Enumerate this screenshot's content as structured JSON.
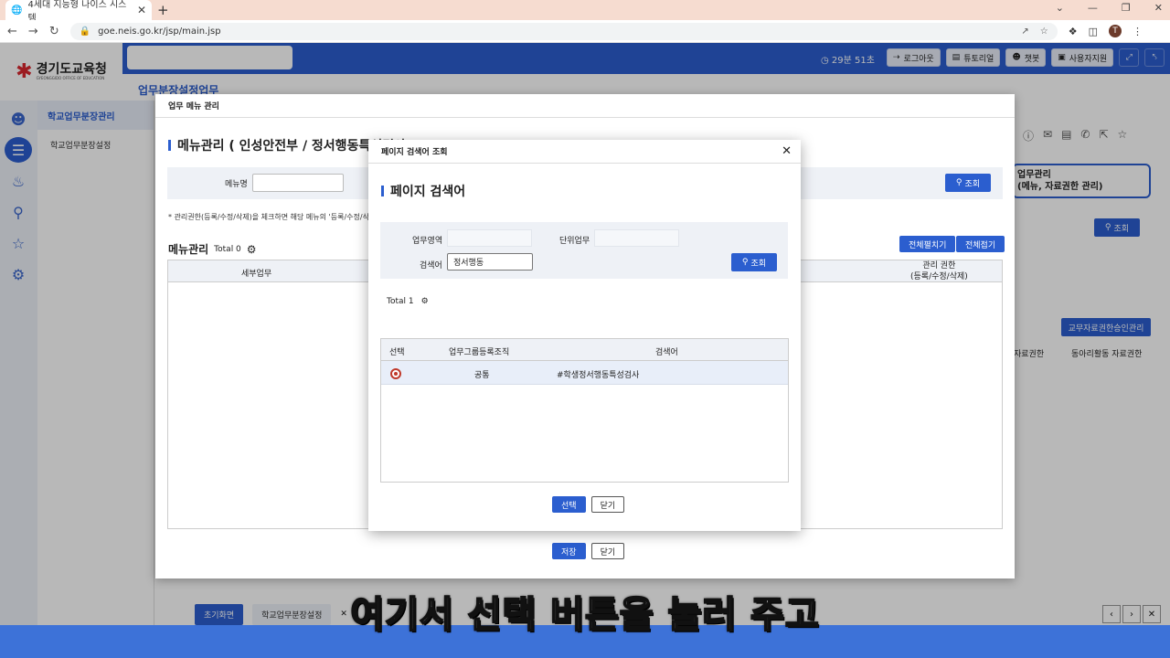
{
  "browser": {
    "tab_title": "4세대 지능형 나이스 시스템",
    "url": "goe.neis.go.kr/jsp/main.jsp",
    "profile_initial": "T"
  },
  "header": {
    "logo_text": "경기도교육청",
    "logo_sub": "GYEONGGIDO OFFICE OF EDUCATION",
    "timer": "29분 51초",
    "buttons": [
      "로그아웃",
      "튜토리얼",
      "챗봇",
      "사용자지원"
    ],
    "menu_title": "업무분장설정업무"
  },
  "sidebar": {
    "head": "학교업무분장관리",
    "item": "학교업무분장설정"
  },
  "background": {
    "card_line1": "업무관리",
    "card_line2": "(메뉴, 자료권한 관리)",
    "search_btn": "조회",
    "approve_btn": "교무자료권한승인관리",
    "col1": "자료권한",
    "col2": "동아리활동 자료권한"
  },
  "modal1": {
    "title": "업무 메뉴 관리",
    "section_title": "메뉴관리 ( 인성안전부 / 정서행동특성검사 )",
    "search_label": "메뉴명",
    "search_btn": "조회",
    "note": "* 관리권한(등록/수정/삭제)을 체크하면 해당 메뉴의 '등록/수정/삭제' 버튼 사용이 가능합니다.",
    "grid_title": "메뉴관리",
    "total": "Total 0",
    "expand_btn": "전체펼치기",
    "collapse_btn": "전체접기",
    "col_sub": "세부업무",
    "col_perm1": "관리 권한",
    "col_perm2": "(등록/수정/삭제)",
    "save_btn": "저장",
    "close_btn": "닫기"
  },
  "modal2": {
    "title": "페이지 검색어 조회",
    "section_title": "페이지 검색어",
    "label_area": "업무영역",
    "label_unit": "단위업무",
    "label_keyword": "검색어",
    "keyword_value": "정서행동",
    "search_btn": "조회",
    "total": "Total 1",
    "columns": [
      "선택",
      "업무그룹등록조직",
      "검색어"
    ],
    "rows": [
      {
        "org": "공통",
        "keyword": "#학생정서행동특성검사"
      }
    ],
    "select_btn": "선택",
    "close_btn": "닫기"
  },
  "bottom_tabs": [
    "초기화면",
    "학교업무분장설정"
  ],
  "subtitle": "여기서 선택 버튼을 눌러 주고"
}
